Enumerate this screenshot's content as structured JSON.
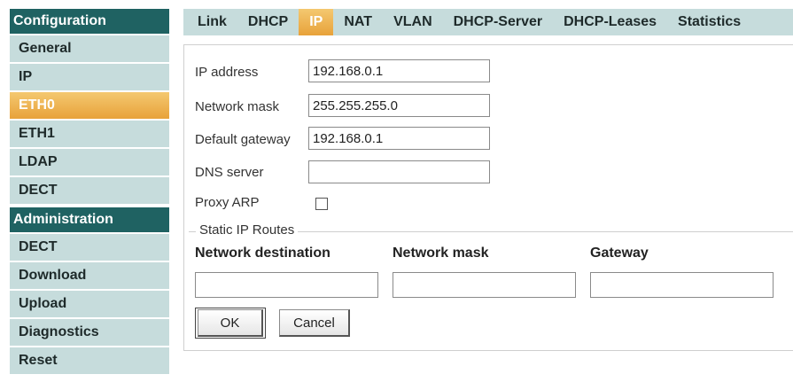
{
  "sidebar": {
    "configuration_header": "Configuration",
    "configuration_items": [
      {
        "label": "General"
      },
      {
        "label": "IP"
      },
      {
        "label": "ETH0",
        "active": true
      },
      {
        "label": "ETH1"
      },
      {
        "label": "LDAP"
      },
      {
        "label": "DECT"
      }
    ],
    "administration_header": "Administration",
    "administration_items": [
      {
        "label": "DECT"
      },
      {
        "label": "Download"
      },
      {
        "label": "Upload"
      },
      {
        "label": "Diagnostics"
      },
      {
        "label": "Reset"
      }
    ]
  },
  "tabs": [
    {
      "label": "Link"
    },
    {
      "label": "DHCP"
    },
    {
      "label": "IP",
      "active": true
    },
    {
      "label": "NAT"
    },
    {
      "label": "VLAN"
    },
    {
      "label": "DHCP-Server"
    },
    {
      "label": "DHCP-Leases"
    },
    {
      "label": "Statistics"
    }
  ],
  "form": {
    "ip_address": {
      "label": "IP address",
      "value": "192.168.0.1"
    },
    "network_mask": {
      "label": "Network mask",
      "value": "255.255.255.0"
    },
    "default_gateway": {
      "label": "Default gateway",
      "value": "192.168.0.1"
    },
    "dns_server": {
      "label": "DNS server",
      "value": ""
    },
    "proxy_arp": {
      "label": "Proxy ARP",
      "checked": false
    }
  },
  "static_routes": {
    "legend": "Static IP Routes",
    "columns": [
      "Network destination",
      "Network mask",
      "Gateway"
    ],
    "row": {
      "destination": "",
      "mask": "",
      "gateway": ""
    }
  },
  "buttons": {
    "ok": "OK",
    "cancel": "Cancel"
  },
  "colors": {
    "header": "#1f6262",
    "item_bg": "#c6dcdc",
    "active": "#e8a23a"
  }
}
